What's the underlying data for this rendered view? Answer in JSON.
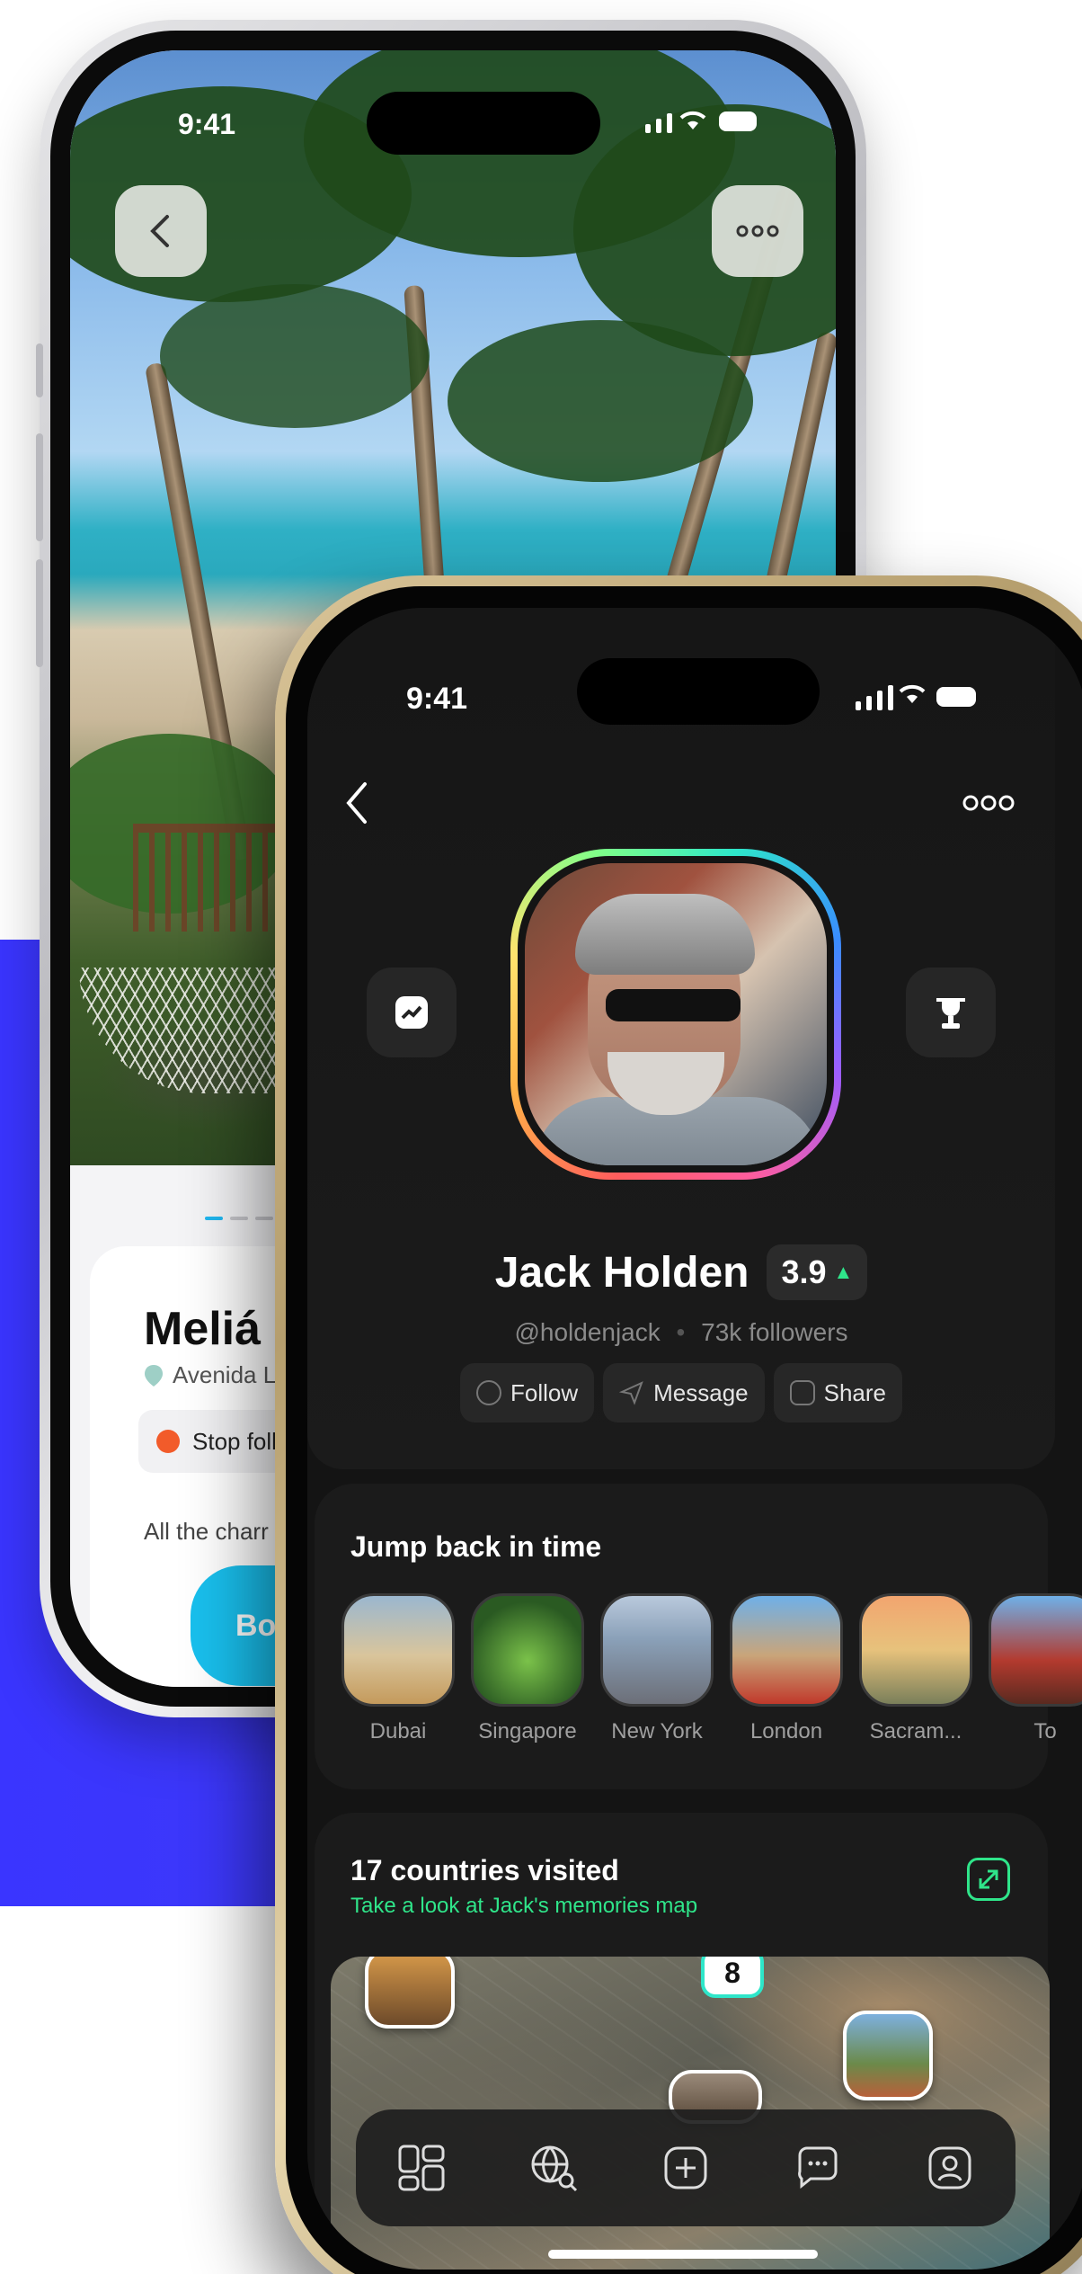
{
  "back_phone": {
    "status_time": "9:41",
    "hotel_title": "Meliá I",
    "address": "Avenida La",
    "stop_label": "Stop follo",
    "description": "All the charr of th va delicious an",
    "book_label": "Book a"
  },
  "front_phone": {
    "status_time": "9:41",
    "profile": {
      "name": "Jack Holden",
      "rating": "3.9",
      "handle": "@holdenjack",
      "followers": "73k followers",
      "actions": [
        {
          "label": "Follow",
          "icon": "user-icon"
        },
        {
          "label": "Message",
          "icon": "send-icon"
        },
        {
          "label": "Share",
          "icon": "share-icon"
        }
      ]
    },
    "jump_back": {
      "title": "Jump back in time",
      "cities": [
        {
          "label": "Dubai",
          "color": "#c9a56a"
        },
        {
          "label": "Singapore",
          "color": "#2f6b34"
        },
        {
          "label": "New York",
          "color": "#7a8fa8"
        },
        {
          "label": "London",
          "color": "#c58b5a"
        },
        {
          "label": "Sacram...",
          "color": "#d98a5c"
        },
        {
          "label": "To",
          "color": "#b33a2e"
        }
      ]
    },
    "countries": {
      "title": "17 countries visited",
      "subtitle": "Take a look at Jack's memories map",
      "map_badge": "8"
    },
    "tabbar": [
      "grid-icon",
      "globe-search-icon",
      "add-icon",
      "chat-icon",
      "profile-icon"
    ]
  },
  "colors": {
    "accent_blue": "#3a35ff",
    "book_button": "#19c0ee",
    "green_accent": "#2fe58a",
    "stop_dot": "#f25b2a"
  }
}
